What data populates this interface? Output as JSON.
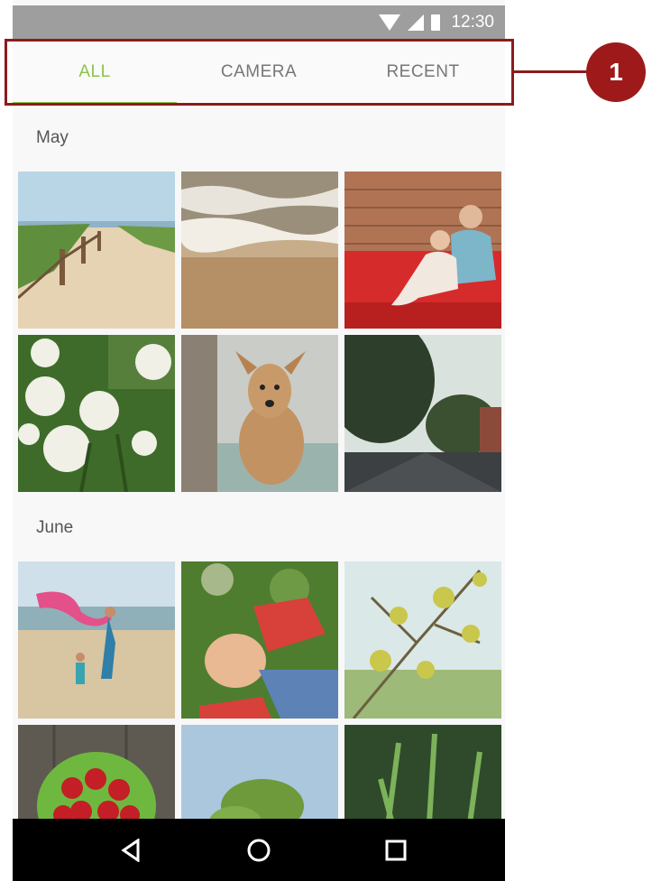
{
  "status_bar": {
    "time": "12:30"
  },
  "tabs": [
    {
      "label": "ALL",
      "active": true
    },
    {
      "label": "CAMERA",
      "active": false
    },
    {
      "label": "RECENT",
      "active": false
    }
  ],
  "sections": [
    {
      "title": "May"
    },
    {
      "title": "June"
    }
  ],
  "photos": {
    "may": [
      "beach-path",
      "ocean-waves",
      "mother-child-reading",
      "white-flowers",
      "dog-portrait",
      "street-trees"
    ],
    "june": [
      "beach-scarf",
      "child-in-grass",
      "blossom-branch",
      "cherries-bowl",
      "tree-sky",
      "grass-plants"
    ]
  },
  "callout": {
    "number": "1"
  },
  "colors": {
    "accent": "#8bc34a",
    "callout": "#9e1a1a",
    "status_bar": "#9e9e9e"
  },
  "nav": {
    "back_icon": "back-triangle-icon",
    "home_icon": "home-circle-icon",
    "recents_icon": "recents-square-icon"
  }
}
